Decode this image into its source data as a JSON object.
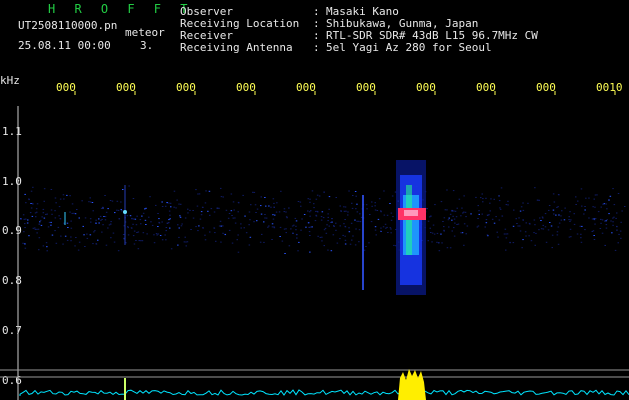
{
  "header": {
    "app_title": "H R O F F T",
    "filename": "UT2508110000.pn",
    "mode": "meteor",
    "date_time": "25.08.11 00:00",
    "count": "3.",
    "fields": [
      {
        "label": "Observer",
        "value": "Masaki Kano"
      },
      {
        "label": "Receiving Location",
        "value": "Shibukawa, Gunma, Japan"
      },
      {
        "label": "Receiver",
        "value": "RTL-SDR SDR# 43dB L15 96.7MHz CW"
      },
      {
        "label": "Receiving Antenna",
        "value": "5el Yagi Az 280 for Seoul"
      }
    ]
  },
  "axis": {
    "y_unit": "kHz",
    "y_ticks": [
      "1.1",
      "1.0",
      "0.9",
      "0.8",
      "0.7",
      "0.6"
    ],
    "x_ticks": [
      "000",
      "000",
      "000",
      "000",
      "000",
      "000",
      "000",
      "000",
      "000",
      "0010"
    ]
  },
  "colors": {
    "background": "#000000",
    "tick_text": "#ffff55",
    "signal_blue": "#1a3cff",
    "signal_core": "#ff3366",
    "level_trace": "#00e5ff",
    "level_peak": "#ffee00"
  }
}
